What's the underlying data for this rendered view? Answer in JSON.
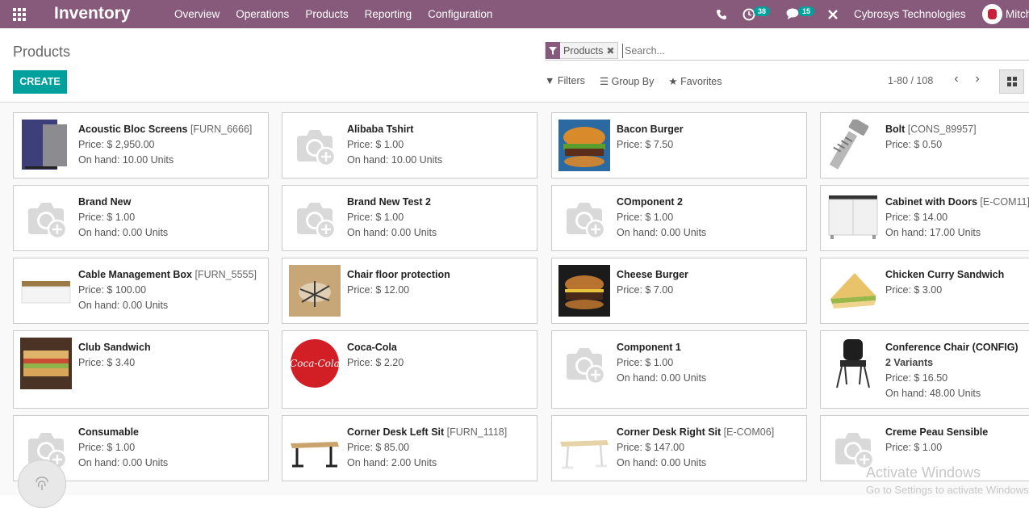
{
  "navbar": {
    "app_name": "Inventory",
    "menu": [
      "Overview",
      "Operations",
      "Products",
      "Reporting",
      "Configuration"
    ],
    "activity_count": "38",
    "messages_count": "15",
    "company": "Cybrosys Technologies",
    "user": "Mitch"
  },
  "control": {
    "breadcrumb": "Products",
    "create_label": "CREATE",
    "facet_label": "Products",
    "search_placeholder": "Search...",
    "filters_label": "Filters",
    "groupby_label": "Group By",
    "favorites_label": "Favorites",
    "pager": "1-80 / 108"
  },
  "products": [
    {
      "name": "Acoustic Bloc Screens",
      "ref": "[FURN_6666]",
      "price": "Price: $ 2,950.00",
      "onhand": "On hand: 10.00 Units",
      "image": "acoustic-screen"
    },
    {
      "name": "Alibaba Tshirt",
      "ref": "",
      "price": "Price: $ 1.00",
      "onhand": "On hand: 10.00 Units",
      "image": "placeholder"
    },
    {
      "name": "Bacon Burger",
      "ref": "",
      "price": "Price: $ 7.50",
      "onhand": "",
      "image": "burger"
    },
    {
      "name": "Bolt",
      "ref": "[CONS_89957]",
      "price": "Price: $ 0.50",
      "onhand": "",
      "image": "bolt"
    },
    {
      "name": "Brand New",
      "ref": "",
      "price": "Price: $ 1.00",
      "onhand": "On hand: 0.00 Units",
      "image": "placeholder"
    },
    {
      "name": "Brand New Test 2",
      "ref": "",
      "price": "Price: $ 1.00",
      "onhand": "On hand: 0.00 Units",
      "image": "placeholder"
    },
    {
      "name": "COmponent 2",
      "ref": "",
      "price": "Price: $ 1.00",
      "onhand": "On hand: 0.00 Units",
      "image": "placeholder"
    },
    {
      "name": "Cabinet with Doors",
      "ref": "[E-COM11]",
      "price": "Price: $ 14.00",
      "onhand": "On hand: 17.00 Units",
      "image": "cabinet"
    },
    {
      "name": "Cable Management Box",
      "ref": "[FURN_5555]",
      "price": "Price: $ 100.00",
      "onhand": "On hand: 0.00 Units",
      "image": "cable-box"
    },
    {
      "name": "Chair floor protection",
      "ref": "",
      "price": "Price: $ 12.00",
      "onhand": "",
      "image": "chair-floor"
    },
    {
      "name": "Cheese Burger",
      "ref": "",
      "price": "Price: $ 7.00",
      "onhand": "",
      "image": "burger-dark"
    },
    {
      "name": "Chicken Curry Sandwich",
      "ref": "",
      "price": "Price: $ 3.00",
      "onhand": "",
      "image": "sandwich"
    },
    {
      "name": "Club Sandwich",
      "ref": "",
      "price": "Price: $ 3.40",
      "onhand": "",
      "image": "club-sandwich"
    },
    {
      "name": "Coca-Cola",
      "ref": "",
      "price": "Price: $ 2.20",
      "onhand": "",
      "image": "coca-cola"
    },
    {
      "name": "Component 1",
      "ref": "",
      "price": "Price: $ 1.00",
      "onhand": "On hand: 0.00 Units",
      "image": "placeholder"
    },
    {
      "name": "Conference Chair (CONFIG)",
      "ref": "",
      "variants": "2 Variants",
      "price": "Price: $ 16.50",
      "onhand": "On hand: 48.00 Units",
      "image": "chair"
    },
    {
      "name": "Consumable",
      "ref": "",
      "price": "Price: $ 1.00",
      "onhand": "On hand: 0.00 Units",
      "image": "placeholder"
    },
    {
      "name": "Corner Desk Left Sit",
      "ref": "[FURN_1118]",
      "price": "Price: $ 85.00",
      "onhand": "On hand: 2.00 Units",
      "image": "desk-dark"
    },
    {
      "name": "Corner Desk Right Sit",
      "ref": "[E-COM06]",
      "price": "Price: $ 147.00",
      "onhand": "On hand: 0.00 Units",
      "image": "desk-light"
    },
    {
      "name": "Creme Peau Sensible",
      "ref": "",
      "price": "Price: $ 1.00",
      "onhand": "",
      "image": "placeholder"
    }
  ],
  "watermark": {
    "line1": "Activate Windows",
    "line2": "Go to Settings to activate Windows."
  }
}
